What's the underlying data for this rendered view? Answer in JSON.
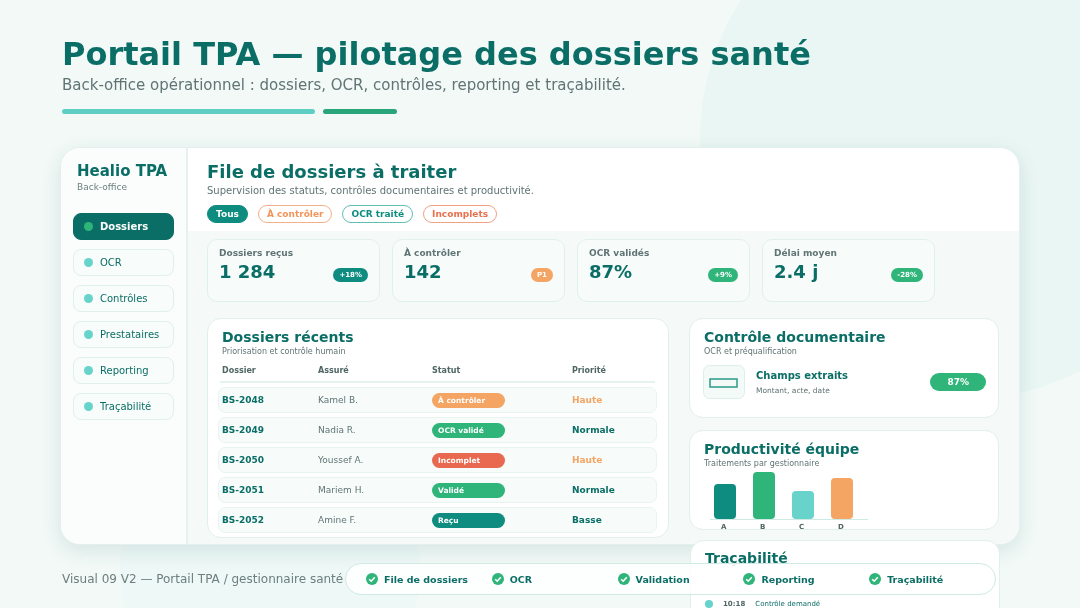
{
  "header": {
    "title": "Portail TPA — pilotage des dossiers santé",
    "subtitle": "Back-office opérationnel : dossiers, OCR, contrôles, reporting et traçabilité."
  },
  "sidebar": {
    "brand": "Healio TPA",
    "tagline": "Back-office",
    "items": [
      {
        "label": "Dossiers",
        "selected": true
      },
      {
        "label": "OCR",
        "selected": false
      },
      {
        "label": "Contrôles",
        "selected": false
      },
      {
        "label": "Prestataires",
        "selected": false
      },
      {
        "label": "Reporting",
        "selected": false
      },
      {
        "label": "Traçabilité",
        "selected": false
      }
    ]
  },
  "main": {
    "title": "File de dossiers à traiter",
    "subtitle": "Supervision des statuts, contrôles documentaires et productivité.",
    "filters": [
      {
        "label": "Tous",
        "selected": true,
        "kind": "neutral"
      },
      {
        "label": "À contrôler",
        "selected": false,
        "kind": "warn"
      },
      {
        "label": "OCR traité",
        "selected": false,
        "kind": "ok"
      },
      {
        "label": "Incomplets",
        "selected": false,
        "kind": "alert"
      }
    ]
  },
  "kpis": [
    {
      "label": "Dossiers reçus",
      "value": "1 284",
      "badge": "+18%",
      "kind": "teal"
    },
    {
      "label": "À contrôler",
      "value": "142",
      "badge": "P1",
      "kind": "orange"
    },
    {
      "label": "OCR validés",
      "value": "87%",
      "badge": "+9%",
      "kind": "green"
    },
    {
      "label": "Délai moyen",
      "value": "2.4 j",
      "badge": "-28%",
      "kind": "green"
    }
  ],
  "recent": {
    "title": "Dossiers récents",
    "subtitle": "Priorisation et contrôle humain",
    "columns": [
      "Dossier",
      "Assuré",
      "Statut",
      "Priorité"
    ],
    "rows": [
      {
        "id": "BS-2048",
        "insured": "Kamel B.",
        "status": {
          "label": "À contrôler",
          "kind": "to_check"
        },
        "priority": {
          "label": "Haute",
          "kind": "high"
        }
      },
      {
        "id": "BS-2049",
        "insured": "Nadia R.",
        "status": {
          "label": "OCR validé",
          "kind": "ocr"
        },
        "priority": {
          "label": "Normale",
          "kind": "normal"
        }
      },
      {
        "id": "BS-2050",
        "insured": "Youssef A.",
        "status": {
          "label": "Incomplet",
          "kind": "incomplete"
        },
        "priority": {
          "label": "Haute",
          "kind": "high"
        }
      },
      {
        "id": "BS-2051",
        "insured": "Mariem H.",
        "status": {
          "label": "Validé",
          "kind": "valid"
        },
        "priority": {
          "label": "Normale",
          "kind": "normal"
        }
      },
      {
        "id": "BS-2052",
        "insured": "Amine F.",
        "status": {
          "label": "Reçu",
          "kind": "received"
        },
        "priority": {
          "label": "Basse",
          "kind": "low"
        }
      }
    ]
  },
  "document_control": {
    "title": "Contrôle documentaire",
    "subtitle": "OCR et préqualification",
    "item_title": "Champs extraits",
    "item_detail": "Montant, acte, date",
    "score": "87%"
  },
  "productivity": {
    "title": "Productivité équipe",
    "subtitle": "Traitements par gestionnaire",
    "bars": [
      {
        "label": "A",
        "color": "#0e8c80"
      },
      {
        "label": "B",
        "color": "#2fb57a"
      },
      {
        "label": "C",
        "color": "#67d3cb"
      },
      {
        "label": "D",
        "color": "#f4a463"
      }
    ]
  },
  "traceability": {
    "title": "Traçabilité",
    "entries": [
      {
        "time": "10:18",
        "text": "Contrôle demandé"
      }
    ]
  },
  "steps": [
    {
      "label": "File de dossiers",
      "done": true
    },
    {
      "label": "OCR",
      "done": true
    },
    {
      "label": "Validation",
      "done": true
    },
    {
      "label": "Reporting",
      "done": true
    },
    {
      "label": "Traçabilité",
      "done": true
    }
  ],
  "footer": "Visual 09 V2 — Portail TPA / gestionnaire santé"
}
